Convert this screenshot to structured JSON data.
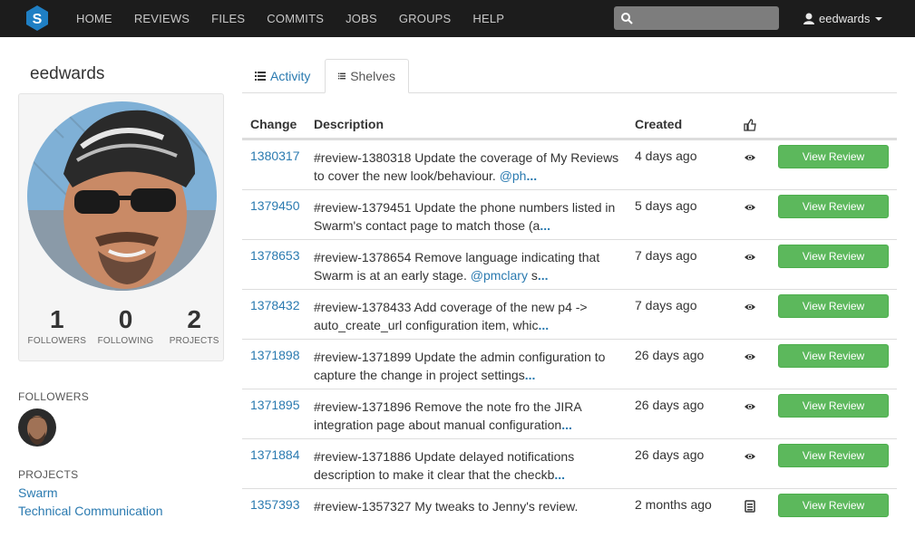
{
  "nav": {
    "items": [
      "HOME",
      "REVIEWS",
      "FILES",
      "COMMITS",
      "JOBS",
      "GROUPS",
      "HELP"
    ],
    "search_placeholder": "",
    "user": "eedwards"
  },
  "profile": {
    "name": "eedwards",
    "stats": [
      {
        "value": "1",
        "label": "FOLLOWERS"
      },
      {
        "value": "0",
        "label": "FOLLOWING"
      },
      {
        "value": "2",
        "label": "PROJECTS"
      }
    ]
  },
  "sidebar": {
    "followers_title": "FOLLOWERS",
    "projects_title": "PROJECTS",
    "projects": [
      "Swarm",
      "Technical Communication"
    ]
  },
  "tabs": {
    "activity": "Activity",
    "shelves": "Shelves"
  },
  "table": {
    "headers": {
      "change": "Change",
      "description": "Description",
      "created": "Created"
    },
    "button_label": "View Review",
    "rows": [
      {
        "change": "1380317",
        "line1": "#review-1380318 Update the coverage of My Reviews",
        "line2": "to cover the new look/behaviour. ",
        "mention": "@ph",
        "mention_rest": "",
        "more": "...",
        "created": "4 days ago",
        "icon": "eye-icon"
      },
      {
        "change": "1379450",
        "line1": "#review-1379451 Update the phone numbers listed in",
        "line2": "Swarm's contact page to match those (a",
        "mention": "",
        "mention_rest": "",
        "more": "...",
        "created": "5 days ago",
        "icon": "eye-icon"
      },
      {
        "change": "1378653",
        "line1": "#review-1378654 Remove language indicating that",
        "line2": "Swarm is at an early stage. ",
        "mention": "@pmclary",
        "mention_rest": " s",
        "more": "...",
        "created": "7 days ago",
        "icon": "eye-icon"
      },
      {
        "change": "1378432",
        "line1": "#review-1378433 Add coverage of the new p4 ->",
        "line2": "auto_create_url configuration item, whic",
        "mention": "",
        "mention_rest": "",
        "more": "...",
        "created": "7 days ago",
        "icon": "eye-icon"
      },
      {
        "change": "1371898",
        "line1": "#review-1371899 Update the admin configuration to",
        "line2": "capture the change in project settings",
        "mention": "",
        "mention_rest": "",
        "more": "...",
        "created": "26 days ago",
        "icon": "eye-icon"
      },
      {
        "change": "1371895",
        "line1": "#review-1371896 Remove the note fro the JIRA",
        "line2": "integration page about manual configuration",
        "mention": "",
        "mention_rest": "",
        "more": "...",
        "created": "26 days ago",
        "icon": "eye-icon"
      },
      {
        "change": "1371884",
        "line1": "#review-1371886 Update delayed notifications",
        "line2": "description to make it clear that the checkb",
        "mention": "",
        "mention_rest": "",
        "more": "...",
        "created": "26 days ago",
        "icon": "eye-icon"
      },
      {
        "change": "1357393",
        "line1": "#review-1357327 My tweaks to Jenny's review.",
        "line2": "",
        "mention": "",
        "mention_rest": "",
        "more": "",
        "created": "2 months ago",
        "icon": "archive-icon"
      }
    ]
  },
  "colors": {
    "navbar": "#1c1c1c",
    "link": "#2a7ab0",
    "button": "#5cb85c"
  }
}
